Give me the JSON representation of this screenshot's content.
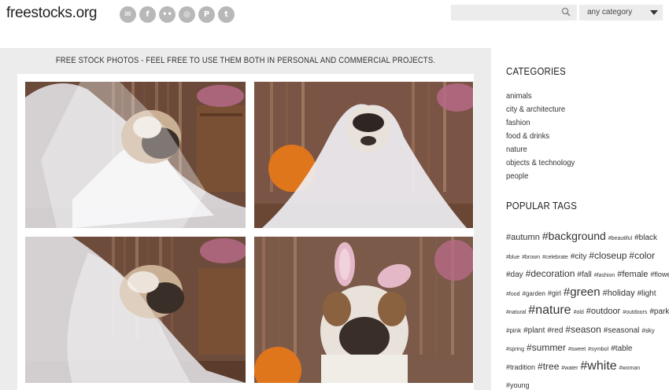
{
  "header": {
    "logo": "freestocks.org",
    "socials": [
      {
        "name": "email-icon",
        "glyph": "✉"
      },
      {
        "name": "facebook-icon",
        "glyph": "f"
      },
      {
        "name": "flickr-icon",
        "glyph": "••"
      },
      {
        "name": "instagram-icon",
        "glyph": "◎"
      },
      {
        "name": "pinterest-icon",
        "glyph": "P"
      },
      {
        "name": "twitter-icon",
        "glyph": "t"
      }
    ],
    "search_placeholder": "",
    "category_select": "any category"
  },
  "main": {
    "tagline": "FREE STOCK PHOTOS - FEEL FREE TO USE THEM BOTH IN PERSONAL AND COMMERCIAL PROJECTS."
  },
  "sidebar": {
    "categories_title": "CATEGORIES",
    "categories": [
      "animals",
      "city & architecture",
      "fashion",
      "food & drinks",
      "nature",
      "objects & technology",
      "people"
    ],
    "tags_title": "POPULAR TAGS",
    "tag_lines": [
      [
        {
          "t": "#autumn",
          "s": 11
        },
        {
          "t": "#background",
          "s": 14
        },
        {
          "t": "#beautiful",
          "s": 7
        },
        {
          "t": "#black",
          "s": 10
        }
      ],
      [
        {
          "t": "#blue",
          "s": 7
        },
        {
          "t": "#brown",
          "s": 7
        },
        {
          "t": "#celebrate",
          "s": 7
        },
        {
          "t": "#city",
          "s": 10
        },
        {
          "t": "#closeup",
          "s": 12
        },
        {
          "t": "#color",
          "s": 12
        }
      ],
      [
        {
          "t": "#day",
          "s": 10
        },
        {
          "t": "#decoration",
          "s": 12
        },
        {
          "t": "#fall",
          "s": 10
        },
        {
          "t": "#fashion",
          "s": 7
        },
        {
          "t": "#female",
          "s": 11
        },
        {
          "t": "#flower",
          "s": 9
        }
      ],
      [
        {
          "t": "#food",
          "s": 7
        },
        {
          "t": "#garden",
          "s": 8
        },
        {
          "t": "#girl",
          "s": 9
        },
        {
          "t": "#green",
          "s": 15
        },
        {
          "t": "#holiday",
          "s": 11
        },
        {
          "t": "#light",
          "s": 10
        }
      ],
      [
        {
          "t": "#natural",
          "s": 7
        },
        {
          "t": "#nature",
          "s": 16
        },
        {
          "t": "#old",
          "s": 7
        },
        {
          "t": "#outdoor",
          "s": 11
        },
        {
          "t": "#outdoors",
          "s": 7
        },
        {
          "t": "#park",
          "s": 10
        }
      ],
      [
        {
          "t": "#pink",
          "s": 8
        },
        {
          "t": "#plant",
          "s": 10
        },
        {
          "t": "#red",
          "s": 10
        },
        {
          "t": "#season",
          "s": 12
        },
        {
          "t": "#seasonal",
          "s": 10
        },
        {
          "t": "#sky",
          "s": 8
        }
      ],
      [
        {
          "t": "#spring",
          "s": 7
        },
        {
          "t": "#summer",
          "s": 12
        },
        {
          "t": "#sweet",
          "s": 7
        },
        {
          "t": "#symbol",
          "s": 7
        },
        {
          "t": "#table",
          "s": 10
        }
      ],
      [
        {
          "t": "#tradition",
          "s": 9
        },
        {
          "t": "#tree",
          "s": 12
        },
        {
          "t": "#water",
          "s": 7
        },
        {
          "t": "#white",
          "s": 16
        },
        {
          "t": "#woman",
          "s": 7
        }
      ],
      [
        {
          "t": "#young",
          "s": 9
        }
      ]
    ]
  }
}
